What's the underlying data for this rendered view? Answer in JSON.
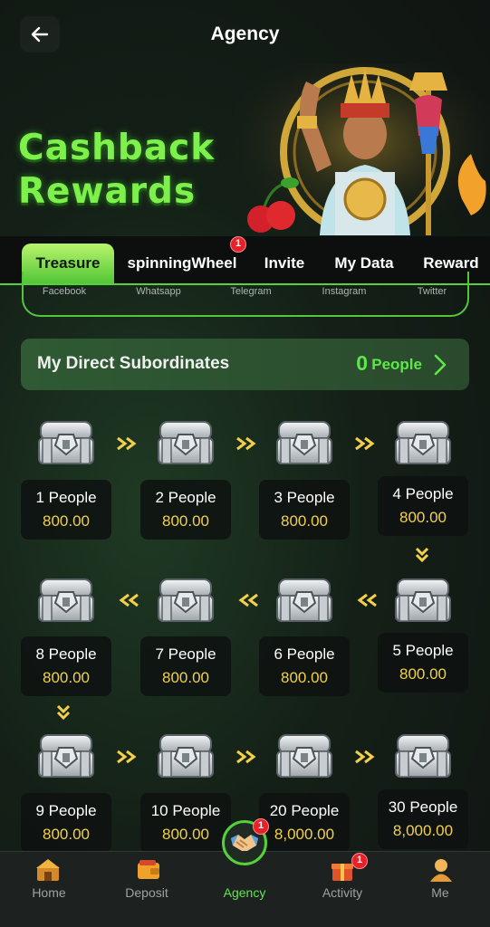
{
  "header": {
    "title": "Agency"
  },
  "banner": {
    "line1": "Cashback",
    "line2": "Rewards"
  },
  "tabs": [
    {
      "label": "Treasure",
      "active": true
    },
    {
      "label": "spinningWheel",
      "badge": "1"
    },
    {
      "label": "Invite"
    },
    {
      "label": "My Data"
    },
    {
      "label": "Reward"
    }
  ],
  "social": [
    "Facebook",
    "Whatsapp",
    "Telegram",
    "Instagram",
    "Twitter"
  ],
  "subordinates": {
    "label": "My Direct Subordinates",
    "count": "0",
    "unit": "People"
  },
  "rewards": [
    {
      "people": "1 People",
      "amount": "800.00"
    },
    {
      "people": "2 People",
      "amount": "800.00"
    },
    {
      "people": "3 People",
      "amount": "800.00"
    },
    {
      "people": "4 People",
      "amount": "800.00"
    },
    {
      "people": "5 People",
      "amount": "800.00"
    },
    {
      "people": "6 People",
      "amount": "800.00"
    },
    {
      "people": "7 People",
      "amount": "800.00"
    },
    {
      "people": "8 People",
      "amount": "800.00"
    },
    {
      "people": "9 People",
      "amount": "800.00"
    },
    {
      "people": "10 People",
      "amount": "800.00"
    },
    {
      "people": "20 People",
      "amount": "8,000.00"
    },
    {
      "people": "30 People",
      "amount": "8,000.00"
    }
  ],
  "nav": [
    {
      "label": "Home",
      "icon": "home-icon"
    },
    {
      "label": "Deposit",
      "icon": "wallet-icon"
    },
    {
      "label": "Agency",
      "icon": "handshake-icon",
      "active": true,
      "badge": "1"
    },
    {
      "label": "Activity",
      "icon": "gift-icon",
      "badge": "1"
    },
    {
      "label": "Me",
      "icon": "user-icon"
    }
  ],
  "colors": {
    "accent": "#55d13a",
    "gold": "#f2d04a",
    "badge": "#e5222a"
  }
}
